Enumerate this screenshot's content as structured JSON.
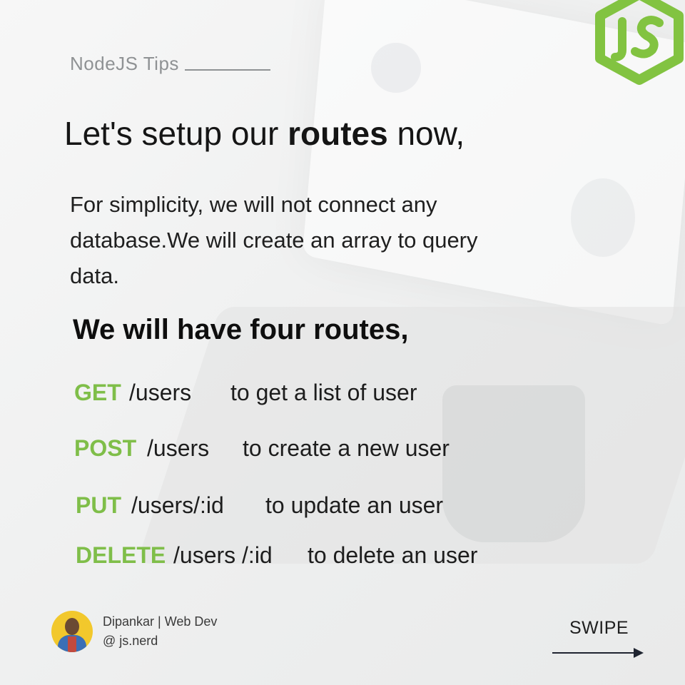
{
  "kicker": "NodeJS Tips",
  "headline": {
    "pre": "Let's setup our ",
    "bold": "routes",
    "post": " now,"
  },
  "intro": "For simplicity, we will not connect any database.We will create an array to query data.",
  "subhead": "We will have four routes,",
  "routes": [
    {
      "method": "GET",
      "path": "/users",
      "desc": "to get a list of user"
    },
    {
      "method": "POST",
      "path": "/users",
      "desc": "to create a new user"
    },
    {
      "method": "PUT",
      "path": "/users/:id",
      "desc": "to update an user"
    },
    {
      "method": "DELETE",
      "path": "/users /:id",
      "desc": "to delete an user"
    }
  ],
  "author": {
    "name": "Dipankar  | Web Dev",
    "handle": "@ js.nerd"
  },
  "swipe": "SWIPE",
  "colors": {
    "accent": "#7fbe49",
    "logo": "#82c341"
  },
  "icons": {
    "logo": "js-hexagon-logo",
    "avatar": "author-avatar",
    "arrow": "arrow-right-icon"
  }
}
